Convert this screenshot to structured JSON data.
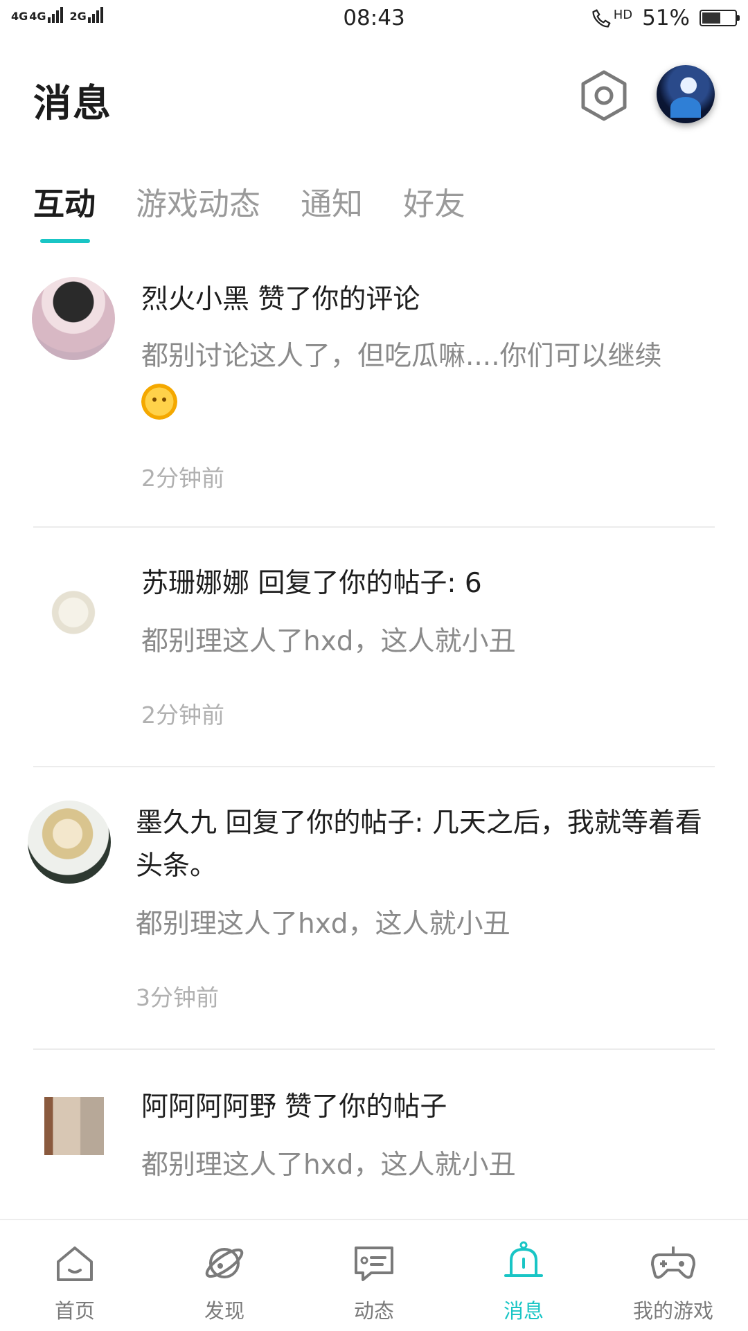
{
  "status_bar": {
    "network_1": "4G",
    "network_2": "4G",
    "network_3": "2G",
    "time": "08:43",
    "hd": "HD",
    "battery": "51%"
  },
  "header": {
    "title": "消息",
    "settings_icon": "hexagon-settings-icon"
  },
  "tabs": [
    {
      "label": "互动",
      "active": true
    },
    {
      "label": "游戏动态",
      "active": false
    },
    {
      "label": "通知",
      "active": false
    },
    {
      "label": "好友",
      "active": false
    }
  ],
  "messages": [
    {
      "title": "烈火小黑 赞了你的评论",
      "body": "都别讨论这人了，但吃瓜嘛....你们可以继续",
      "emoji": "sun-face-emoji",
      "time": "2分钟前"
    },
    {
      "title": "苏珊娜娜 回复了你的帖子: 6",
      "body": "都别理这人了hxd，这人就小丑",
      "time": "2分钟前"
    },
    {
      "title": "墨久九 回复了你的帖子: 几天之后，我就等着看头条。",
      "body": "都别理这人了hxd，这人就小丑",
      "time": "3分钟前"
    },
    {
      "title": "阿阿阿阿野 赞了你的帖子",
      "body": "都别理这人了hxd，这人就小丑",
      "time": ""
    }
  ],
  "bottom_nav": [
    {
      "label": "首页",
      "icon": "home-icon",
      "active": false
    },
    {
      "label": "发现",
      "icon": "planet-icon",
      "active": false
    },
    {
      "label": "动态",
      "icon": "chat-card-icon",
      "active": false
    },
    {
      "label": "消息",
      "icon": "bell-icon",
      "active": true
    },
    {
      "label": "我的游戏",
      "icon": "gamepad-icon",
      "active": false
    }
  ],
  "colors": {
    "accent": "#19c5c5",
    "text": "#1e1e1e",
    "muted": "#8a8a8a"
  }
}
